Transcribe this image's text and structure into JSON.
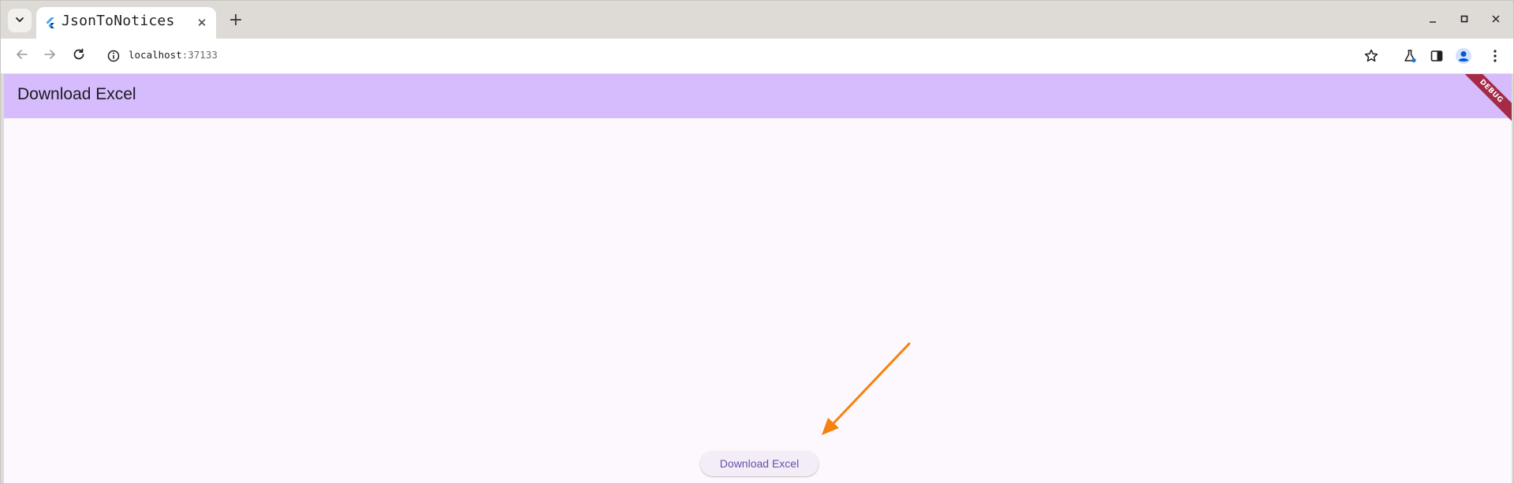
{
  "browser": {
    "tab": {
      "title": "JsonToNotices",
      "favicon": "flutter-icon",
      "close_glyph": "✕"
    },
    "new_tab_glyph": "+",
    "address": {
      "host": "localhost",
      "port": ":37133"
    },
    "icons": {
      "tab_search": "chevron-down-icon",
      "back": "back-arrow-icon",
      "forward": "forward-arrow-icon",
      "reload": "reload-icon",
      "site_info": "info-icon",
      "bookmark": "star-icon",
      "labs": "flask-icon",
      "side_panel": "side-panel-icon",
      "profile": "profile-icon",
      "menu": "kebab-menu-icon",
      "minimize": "minimize-icon",
      "maximize": "maximize-icon",
      "close": "close-icon"
    }
  },
  "app": {
    "appbar_title": "Download Excel",
    "debug_banner": "DEBUG",
    "download_button_label": "Download Excel"
  },
  "colors": {
    "appbar": "#d6bcfc",
    "page_background": "#fdf8fd",
    "button_text": "#6750a4",
    "button_background": "#f4edf8",
    "debug_banner": "#a42a45",
    "annotation_arrow": "#f5820f"
  }
}
